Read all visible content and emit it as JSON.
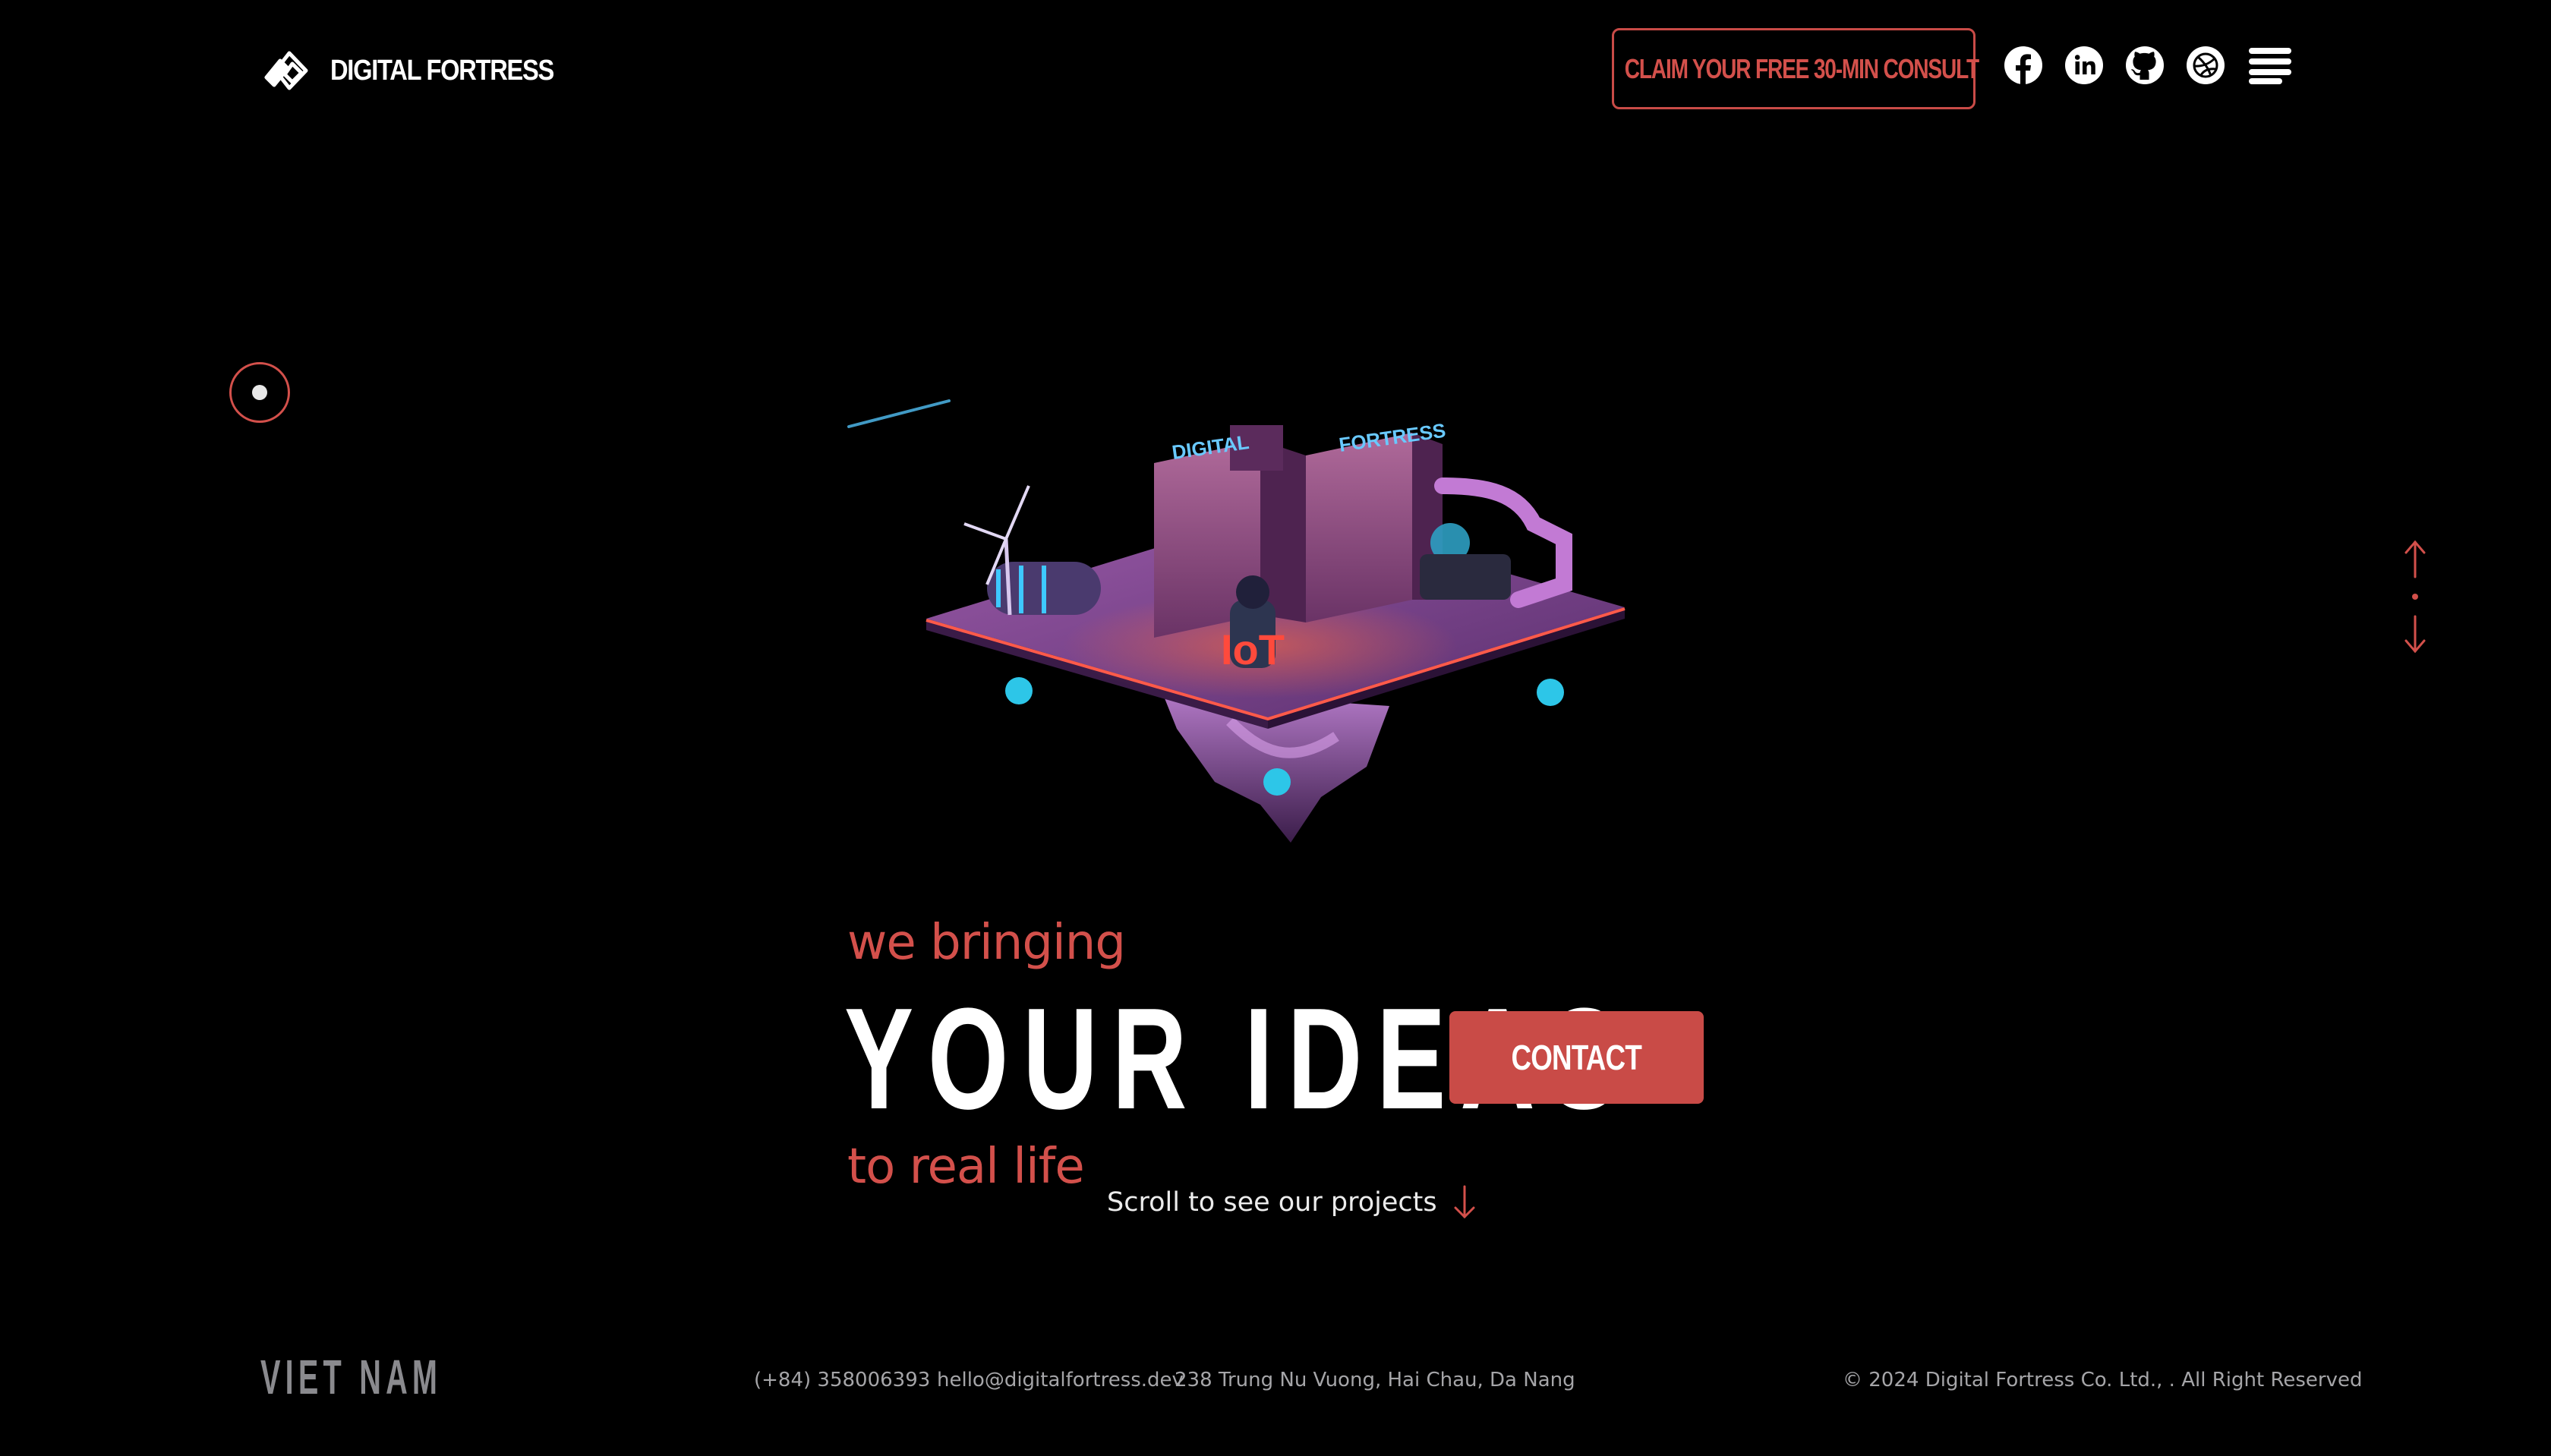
{
  "brand": {
    "name": "DIGITAL FORTRESS"
  },
  "header": {
    "consult_label": "CLAIM YOUR FREE 30-MIN CONSULT",
    "social": [
      "facebook",
      "linkedin",
      "github",
      "dribbble"
    ],
    "menu_icon": "hamburger-menu-icon"
  },
  "hero": {
    "tagline_top": "we bringing",
    "headline": "YOUR IDEAS",
    "tagline_bottom": "to real life",
    "contact_label": "CONTACT",
    "scroll_hint": "Scroll to see our projects",
    "art_sign_left": "DIGITAL",
    "art_sign_right": "FORTRESS",
    "art_label": "IoT"
  },
  "footer": {
    "country": "VIET NAM",
    "phone": "(+84) 358006393",
    "email": "hello@digitalfortress.dev",
    "address": "238 Trung Nu Vuong, Hai Chau, Da Nang",
    "copyright": "© 2024 Digital Fortress Co. Ltd., . All Right Reserved"
  },
  "colors": {
    "background": "#000000",
    "accent": "#d3504b",
    "text": "#ffffff",
    "muted": "#a5a5a8"
  }
}
